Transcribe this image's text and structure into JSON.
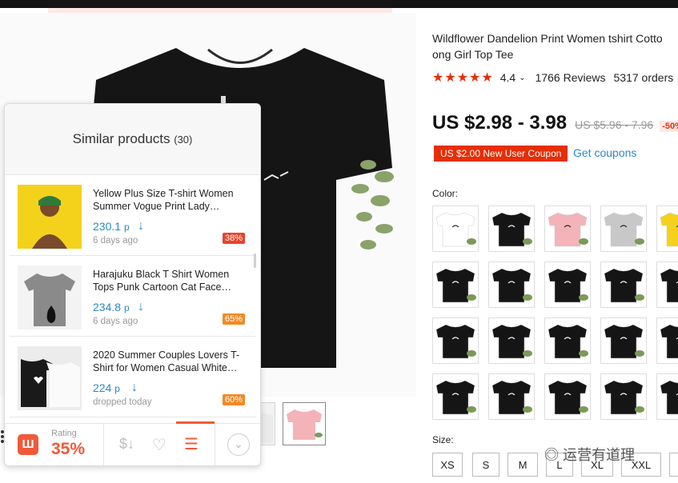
{
  "product": {
    "title": "Wildflower Dandelion Print Women tshirt Cotto ong Girl Top Tee",
    "rating": "4.4",
    "reviews": "1766 Reviews",
    "orders": "5317 orders",
    "price": "US $2.98 - 3.98",
    "old_price": "US $5.96 - 7.96",
    "discount": "-50%",
    "coupon": "US $2.00 New User Coupon",
    "get_coupons": "Get coupons",
    "color_label": "Color:",
    "size_label": "Size:",
    "sizes": [
      "XS",
      "S",
      "M",
      "L",
      "XL",
      "XXL"
    ]
  },
  "popup": {
    "title": "Similar products",
    "count": "(30)",
    "items": [
      {
        "title": "Yellow Plus Size T-shirt Women Summer Vogue Print Lady…",
        "price": "230.1",
        "currency": "р",
        "date": "6 days ago",
        "badge": "38%"
      },
      {
        "title": "Harajuku Black T Shirt Women Tops Punk Cartoon Cat Face…",
        "price": "234.8",
        "currency": "р",
        "date": "6 days ago",
        "badge": "65%"
      },
      {
        "title": "2020 Summer Couples Lovers T-Shirt for Women Casual White…",
        "price": "224",
        "currency": "р",
        "date": "dropped today",
        "badge": "60%"
      }
    ],
    "footer": {
      "rating_label": "Rating",
      "rating_value": "35%",
      "logo": "Ш"
    }
  },
  "watermark": "运营有道理",
  "colors": {
    "accent": "#e62e04",
    "link": "#2a88c7",
    "popup_accent": "#f05a3a",
    "badge_red": "#e8452c",
    "badge_orange": "#f08a24"
  }
}
